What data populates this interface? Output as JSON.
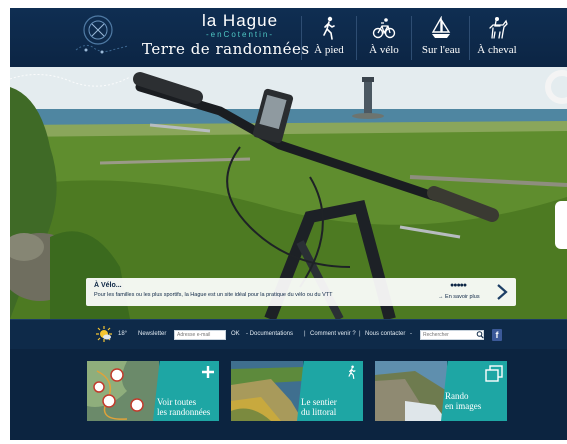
{
  "brand": {
    "name": "la Hague",
    "sub": "-enCotentin-",
    "title": "Terre de randonnées"
  },
  "nav": [
    {
      "label": "À pied",
      "icon": "walker-icon"
    },
    {
      "label": "À vélo",
      "icon": "bicycle-icon"
    },
    {
      "label": "Sur l'eau",
      "icon": "sailboat-icon"
    },
    {
      "label": "À cheval",
      "icon": "horse-rider-icon"
    }
  ],
  "caption": {
    "title": "À Vélo...",
    "text": "Pour les familles ou les plus sportifs, la Hague est un site idéal pour la pratique du vélo ou du VTT",
    "dots": "●●●●●",
    "more": "→  En savoir plus"
  },
  "toolbar": {
    "temperature": "18°",
    "newsletter_label": "Newsletter",
    "newsletter_placeholder": "Adresse e-mail",
    "ok": "OK",
    "documentations": "- Documentations",
    "comment_venir": "Comment venir ?",
    "nous_contacter": "Nous contacter",
    "search_placeholder": "Rechercher",
    "facebook": "f",
    "sep": "|",
    "dash": "-"
  },
  "tiles": [
    {
      "label_1": "Voir toutes",
      "label_2": "les randonnées",
      "icon": "plus-icon"
    },
    {
      "label_1": "Le sentier",
      "label_2": "du littoral",
      "icon": "walker-icon"
    },
    {
      "label_1": "Rando",
      "label_2": "en images",
      "icon": "photos-icon"
    }
  ],
  "colors": {
    "navy": "#0e2a49",
    "teal": "#1ea6a4",
    "accent_text": "#4fc7c4"
  }
}
